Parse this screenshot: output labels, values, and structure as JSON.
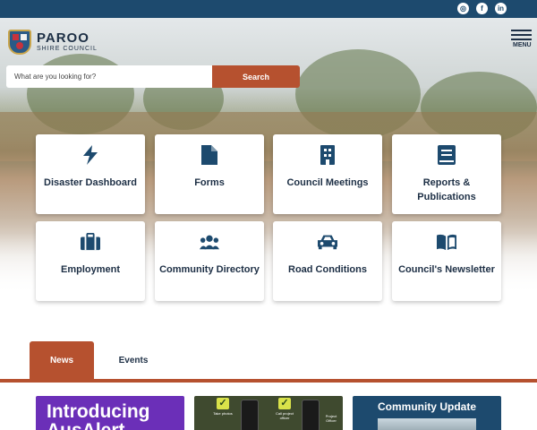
{
  "header": {
    "social": [
      {
        "name": "instagram",
        "glyph": "◎"
      },
      {
        "name": "facebook",
        "glyph": "f"
      },
      {
        "name": "linkedin",
        "glyph": "in"
      }
    ],
    "logo": {
      "main": "PAROO",
      "sub": "SHIRE COUNCIL"
    },
    "menu_label": "MENU"
  },
  "search": {
    "placeholder": "What are you looking for?",
    "button_label": "Search"
  },
  "quick_links": [
    {
      "label": "Disaster Dashboard",
      "icon": "lightning-icon"
    },
    {
      "label": "Forms",
      "icon": "document-icon"
    },
    {
      "label": "Council Meetings",
      "icon": "building-icon"
    },
    {
      "label": "Reports & Publications",
      "icon": "book-icon"
    },
    {
      "label": "Employment",
      "icon": "briefcase-icon"
    },
    {
      "label": "Community Directory",
      "icon": "people-icon"
    },
    {
      "label": "Road Conditions",
      "icon": "car-icon"
    },
    {
      "label": "Council's Newsletter",
      "icon": "open-book-icon"
    }
  ],
  "tabs": [
    {
      "label": "News",
      "active": true
    },
    {
      "label": "Events",
      "active": false
    }
  ],
  "news_cards": {
    "card1": {
      "line1": "Introducing",
      "line2": "AusAlert"
    },
    "card2": {
      "captions": [
        "Take photos",
        "Call project officer",
        "Project Officer"
      ]
    },
    "card3": {
      "title": "Community Update"
    }
  },
  "colors": {
    "brand_navy": "#1d4a6e",
    "accent": "#b6512f",
    "tile_text": "#1d2f45"
  }
}
